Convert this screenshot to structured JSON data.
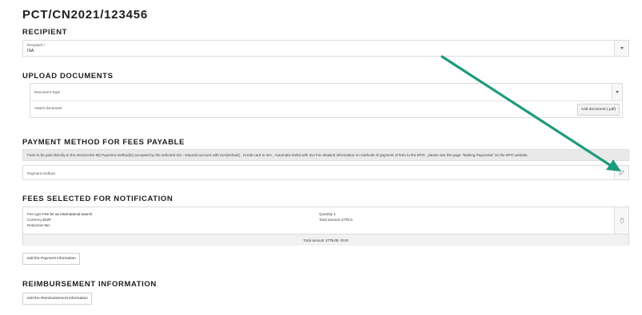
{
  "page": {
    "title": "PCT/CN2021/123456"
  },
  "recipient": {
    "heading": "RECIPIENT",
    "field_label": "Recipient *",
    "field_value": "ISA"
  },
  "upload": {
    "heading": "UPLOAD DOCUMENTS",
    "doc_type_placeholder": "Document Type",
    "attach_label": "Attach document",
    "add_button": "Add document (.pdf)"
  },
  "payment": {
    "heading": "PAYMENT METHOD FOR FEES PAYABLE",
    "info": "Fees to be paid directly to the ISA(not the IB).Payment method(s) accepted by the selected ISA : Deposit account with ISA(Default) , Credit card to ISA , Automatic Debit with ISA For detailed information on methods of payment of fees to the EPO , please see the page \"Making Payments\" on the EPO website.",
    "method_placeholder": "Payment method"
  },
  "fees": {
    "heading": "FEES SELECTED FOR NOTIFICATION",
    "fee_type_label": "Fee type",
    "fee_type_value": "Fee for an international search",
    "currency_label": "Currency",
    "currency_value": "EUR",
    "reduction_label": "Reduction",
    "reduction_value": "No",
    "quantity_label": "Quantity",
    "quantity_value": "1",
    "total_label": "Total amount",
    "total_value": "1775.0",
    "grand_total_label": "Total amount",
    "grand_total_value": "1775.00",
    "grand_total_currency": "EUR",
    "add_payment_button": "Add the Payment information"
  },
  "reimbursement": {
    "heading": "REIMBURSEMENT INFORMATION",
    "add_button": "Add the Reimbursement information"
  },
  "colors": {
    "arrow": "#1f9a7d"
  }
}
